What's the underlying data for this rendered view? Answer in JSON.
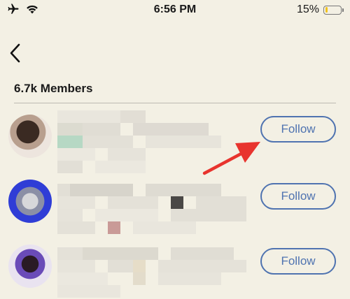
{
  "status_bar": {
    "time": "6:56 PM",
    "battery_percent": "15%",
    "battery_level": 0.15,
    "icons": [
      "airplane-icon",
      "wifi-icon",
      "battery-icon"
    ]
  },
  "nav": {
    "back_icon": "chevron-left-icon"
  },
  "members": {
    "heading": "6.7k Members",
    "follow_label": "Follow",
    "rows": [
      {
        "follow_label": "Follow"
      },
      {
        "follow_label": "Follow"
      },
      {
        "follow_label": "Follow"
      }
    ]
  },
  "colors": {
    "background": "#f3f0e4",
    "follow_accent": "#4f73b0",
    "annotation_arrow": "#e8342e",
    "battery_low": "#f1c21b"
  }
}
